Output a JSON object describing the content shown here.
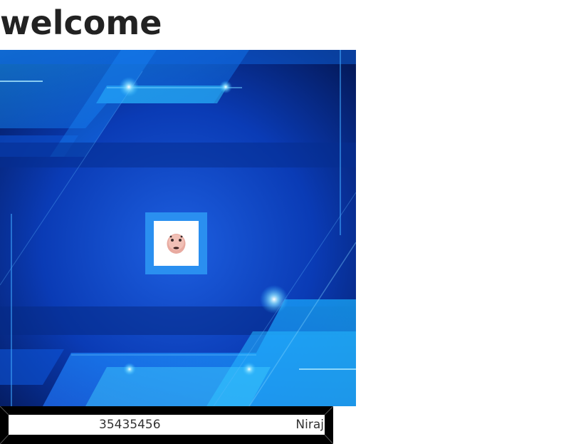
{
  "page": {
    "title": "welcome"
  },
  "hero": {
    "image": "blue-tech-abstract-background",
    "avatar_icon": "face-emoji-icon"
  },
  "info": {
    "number": "35435456",
    "name": "Niraj"
  },
  "colors": {
    "title_text": "#222222",
    "hero_base": "#0a2a8a",
    "avatar_frame": "#2a8ff0",
    "info_bar": "#000000"
  }
}
